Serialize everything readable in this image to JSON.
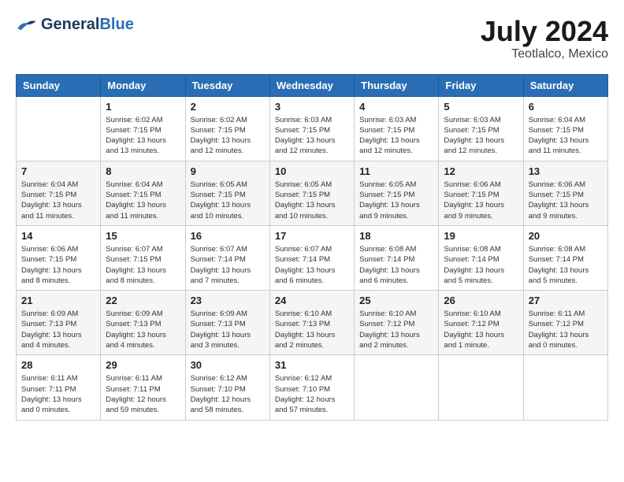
{
  "logo": {
    "text_general": "General",
    "text_blue": "Blue"
  },
  "title": {
    "month_year": "July 2024",
    "location": "Teotlalco, Mexico"
  },
  "weekdays": [
    "Sunday",
    "Monday",
    "Tuesday",
    "Wednesday",
    "Thursday",
    "Friday",
    "Saturday"
  ],
  "weeks": [
    [
      {
        "day": "",
        "info": ""
      },
      {
        "day": "1",
        "info": "Sunrise: 6:02 AM\nSunset: 7:15 PM\nDaylight: 13 hours\nand 13 minutes."
      },
      {
        "day": "2",
        "info": "Sunrise: 6:02 AM\nSunset: 7:15 PM\nDaylight: 13 hours\nand 12 minutes."
      },
      {
        "day": "3",
        "info": "Sunrise: 6:03 AM\nSunset: 7:15 PM\nDaylight: 13 hours\nand 12 minutes."
      },
      {
        "day": "4",
        "info": "Sunrise: 6:03 AM\nSunset: 7:15 PM\nDaylight: 13 hours\nand 12 minutes."
      },
      {
        "day": "5",
        "info": "Sunrise: 6:03 AM\nSunset: 7:15 PM\nDaylight: 13 hours\nand 12 minutes."
      },
      {
        "day": "6",
        "info": "Sunrise: 6:04 AM\nSunset: 7:15 PM\nDaylight: 13 hours\nand 11 minutes."
      }
    ],
    [
      {
        "day": "7",
        "info": "Sunrise: 6:04 AM\nSunset: 7:15 PM\nDaylight: 13 hours\nand 11 minutes."
      },
      {
        "day": "8",
        "info": "Sunrise: 6:04 AM\nSunset: 7:15 PM\nDaylight: 13 hours\nand 11 minutes."
      },
      {
        "day": "9",
        "info": "Sunrise: 6:05 AM\nSunset: 7:15 PM\nDaylight: 13 hours\nand 10 minutes."
      },
      {
        "day": "10",
        "info": "Sunrise: 6:05 AM\nSunset: 7:15 PM\nDaylight: 13 hours\nand 10 minutes."
      },
      {
        "day": "11",
        "info": "Sunrise: 6:05 AM\nSunset: 7:15 PM\nDaylight: 13 hours\nand 9 minutes."
      },
      {
        "day": "12",
        "info": "Sunrise: 6:06 AM\nSunset: 7:15 PM\nDaylight: 13 hours\nand 9 minutes."
      },
      {
        "day": "13",
        "info": "Sunrise: 6:06 AM\nSunset: 7:15 PM\nDaylight: 13 hours\nand 9 minutes."
      }
    ],
    [
      {
        "day": "14",
        "info": "Sunrise: 6:06 AM\nSunset: 7:15 PM\nDaylight: 13 hours\nand 8 minutes."
      },
      {
        "day": "15",
        "info": "Sunrise: 6:07 AM\nSunset: 7:15 PM\nDaylight: 13 hours\nand 8 minutes."
      },
      {
        "day": "16",
        "info": "Sunrise: 6:07 AM\nSunset: 7:14 PM\nDaylight: 13 hours\nand 7 minutes."
      },
      {
        "day": "17",
        "info": "Sunrise: 6:07 AM\nSunset: 7:14 PM\nDaylight: 13 hours\nand 6 minutes."
      },
      {
        "day": "18",
        "info": "Sunrise: 6:08 AM\nSunset: 7:14 PM\nDaylight: 13 hours\nand 6 minutes."
      },
      {
        "day": "19",
        "info": "Sunrise: 6:08 AM\nSunset: 7:14 PM\nDaylight: 13 hours\nand 5 minutes."
      },
      {
        "day": "20",
        "info": "Sunrise: 6:08 AM\nSunset: 7:14 PM\nDaylight: 13 hours\nand 5 minutes."
      }
    ],
    [
      {
        "day": "21",
        "info": "Sunrise: 6:09 AM\nSunset: 7:13 PM\nDaylight: 13 hours\nand 4 minutes."
      },
      {
        "day": "22",
        "info": "Sunrise: 6:09 AM\nSunset: 7:13 PM\nDaylight: 13 hours\nand 4 minutes."
      },
      {
        "day": "23",
        "info": "Sunrise: 6:09 AM\nSunset: 7:13 PM\nDaylight: 13 hours\nand 3 minutes."
      },
      {
        "day": "24",
        "info": "Sunrise: 6:10 AM\nSunset: 7:13 PM\nDaylight: 13 hours\nand 2 minutes."
      },
      {
        "day": "25",
        "info": "Sunrise: 6:10 AM\nSunset: 7:12 PM\nDaylight: 13 hours\nand 2 minutes."
      },
      {
        "day": "26",
        "info": "Sunrise: 6:10 AM\nSunset: 7:12 PM\nDaylight: 13 hours\nand 1 minute."
      },
      {
        "day": "27",
        "info": "Sunrise: 6:11 AM\nSunset: 7:12 PM\nDaylight: 13 hours\nand 0 minutes."
      }
    ],
    [
      {
        "day": "28",
        "info": "Sunrise: 6:11 AM\nSunset: 7:11 PM\nDaylight: 13 hours\nand 0 minutes."
      },
      {
        "day": "29",
        "info": "Sunrise: 6:11 AM\nSunset: 7:11 PM\nDaylight: 12 hours\nand 59 minutes."
      },
      {
        "day": "30",
        "info": "Sunrise: 6:12 AM\nSunset: 7:10 PM\nDaylight: 12 hours\nand 58 minutes."
      },
      {
        "day": "31",
        "info": "Sunrise: 6:12 AM\nSunset: 7:10 PM\nDaylight: 12 hours\nand 57 minutes."
      },
      {
        "day": "",
        "info": ""
      },
      {
        "day": "",
        "info": ""
      },
      {
        "day": "",
        "info": ""
      }
    ]
  ]
}
